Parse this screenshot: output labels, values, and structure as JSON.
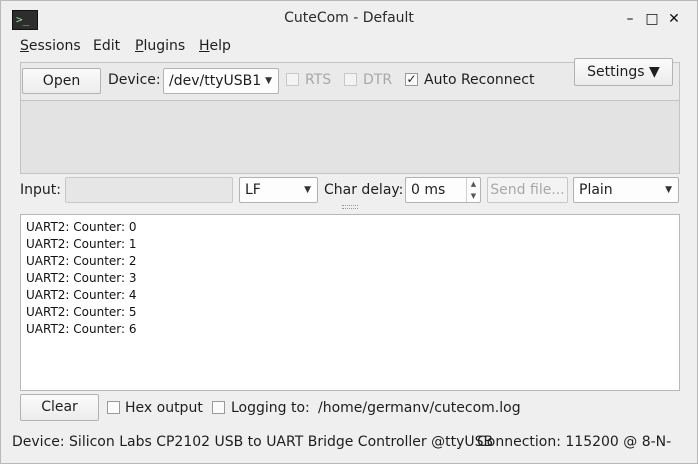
{
  "window": {
    "title": "CuteCom - Default",
    "icon": "terminal-icon"
  },
  "window_controls": {
    "minimize": "minimize-icon",
    "maximize": "maximize-icon",
    "close": "close-icon"
  },
  "menu": {
    "sessions": {
      "first": "S",
      "rest": "essions"
    },
    "edit": "Edit",
    "plugins": {
      "first": "P",
      "rest": "lugins"
    },
    "help": {
      "first": "H",
      "rest": "elp"
    }
  },
  "toolbar": {
    "open_label": "Open",
    "device_label": "Device:",
    "device_value": "/dev/ttyUSB1",
    "rts_label": "RTS",
    "dtr_label": "DTR",
    "auto_reconnect_label": "Auto Reconnect",
    "auto_reconnect_checked": true,
    "settings_label": "Settings ▼"
  },
  "input_row": {
    "input_label": "Input:",
    "input_value": "",
    "line_ending": "LF",
    "char_delay_label": "Char delay:",
    "char_delay_value": "0 ms",
    "send_file_label": "Send file...",
    "format_value": "Plain"
  },
  "output": {
    "lines": [
      "UART2: Counter: 0",
      "UART2: Counter: 1",
      "UART2: Counter: 2",
      "UART2: Counter: 3",
      "UART2: Counter: 4",
      "UART2: Counter: 5",
      "UART2: Counter: 6"
    ]
  },
  "bottom": {
    "clear_label": "Clear",
    "hex_output_label": "Hex output",
    "logging_label": "Logging to:",
    "log_path": "/home/germanv/cutecom.log"
  },
  "status": {
    "device": "Device:  Silicon Labs CP2102 USB to UART Bridge Controller @ttyUSB",
    "connection": "Connection:  115200 @ 8-N-"
  }
}
